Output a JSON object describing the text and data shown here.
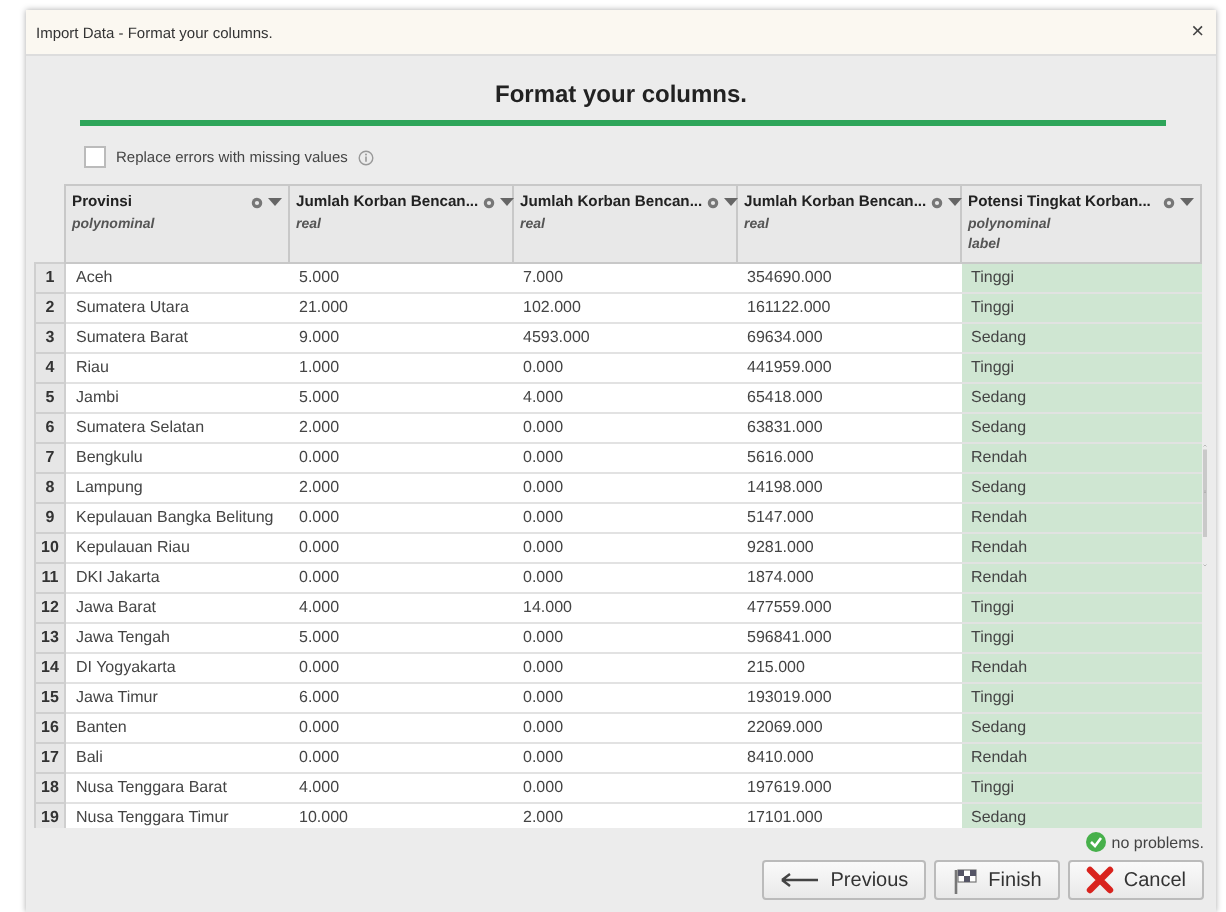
{
  "window": {
    "title": "Import Data - Format your columns.",
    "close": "×"
  },
  "heading": "Format your columns.",
  "progress": {
    "level": 1
  },
  "replace_errors": {
    "label": "Replace errors with missing values",
    "checked": false
  },
  "table": {
    "columns": [
      {
        "name": "Provinsi",
        "type": "polynominal"
      },
      {
        "name": "Jumlah Korban Bencan...",
        "type": "real"
      },
      {
        "name": "Jumlah Korban Bencan...",
        "type": "real"
      },
      {
        "name": "Jumlah Korban Bencan...",
        "type": "real"
      },
      {
        "name": "Potensi Tingkat Korban...",
        "type": "polynominal",
        "role": "label"
      }
    ],
    "rows": [
      {
        "number": "1",
        "cells": [
          "Aceh",
          "5.000",
          "7.000",
          "354690.000",
          "Tinggi"
        ]
      },
      {
        "number": "2",
        "cells": [
          "Sumatera Utara",
          "21.000",
          "102.000",
          "161122.000",
          "Tinggi"
        ]
      },
      {
        "number": "3",
        "cells": [
          "Sumatera Barat",
          "9.000",
          "4593.000",
          "69634.000",
          "Sedang"
        ]
      },
      {
        "number": "4",
        "cells": [
          "Riau",
          "1.000",
          "0.000",
          "441959.000",
          "Tinggi"
        ]
      },
      {
        "number": "5",
        "cells": [
          "Jambi",
          "5.000",
          "4.000",
          "65418.000",
          "Sedang"
        ]
      },
      {
        "number": "6",
        "cells": [
          "Sumatera Selatan",
          "2.000",
          "0.000",
          "63831.000",
          "Sedang"
        ]
      },
      {
        "number": "7",
        "cells": [
          "Bengkulu",
          "0.000",
          "0.000",
          "5616.000",
          "Rendah"
        ]
      },
      {
        "number": "8",
        "cells": [
          "Lampung",
          "2.000",
          "0.000",
          "14198.000",
          "Sedang"
        ]
      },
      {
        "number": "9",
        "cells": [
          "Kepulauan Bangka Belitung",
          "0.000",
          "0.000",
          "5147.000",
          "Rendah"
        ]
      },
      {
        "number": "10",
        "cells": [
          "Kepulauan Riau",
          "0.000",
          "0.000",
          "9281.000",
          "Rendah"
        ]
      },
      {
        "number": "11",
        "cells": [
          "DKI Jakarta",
          "0.000",
          "0.000",
          "1874.000",
          "Rendah"
        ]
      },
      {
        "number": "12",
        "cells": [
          "Jawa Barat",
          "4.000",
          "14.000",
          "477559.000",
          "Tinggi"
        ]
      },
      {
        "number": "13",
        "cells": [
          "Jawa Tengah",
          "5.000",
          "0.000",
          "596841.000",
          "Tinggi"
        ]
      },
      {
        "number": "14",
        "cells": [
          "DI Yogyakarta",
          "0.000",
          "0.000",
          "215.000",
          "Rendah"
        ]
      },
      {
        "number": "15",
        "cells": [
          "Jawa Timur",
          "6.000",
          "0.000",
          "193019.000",
          "Tinggi"
        ]
      },
      {
        "number": "16",
        "cells": [
          "Banten",
          "0.000",
          "0.000",
          "22069.000",
          "Sedang"
        ]
      },
      {
        "number": "17",
        "cells": [
          "Bali",
          "0.000",
          "0.000",
          "8410.000",
          "Rendah"
        ]
      },
      {
        "number": "18",
        "cells": [
          "Nusa Tenggara Barat",
          "4.000",
          "0.000",
          "197619.000",
          "Tinggi"
        ]
      },
      {
        "number": "19",
        "cells": [
          "Nusa Tenggara Timur",
          "10.000",
          "2.000",
          "17101.000",
          "Sedang"
        ]
      }
    ]
  },
  "status": "no problems.",
  "buttons": [
    {
      "label": "Previous",
      "kind": "previous"
    },
    {
      "label": "Finish",
      "kind": "finish"
    },
    {
      "label": "Cancel",
      "kind": "cancel"
    }
  ]
}
